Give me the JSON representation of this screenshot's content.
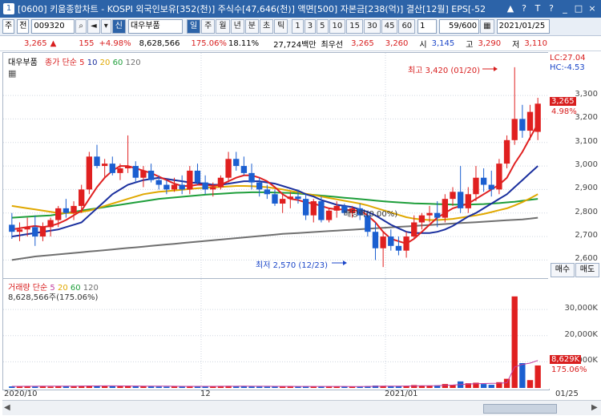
{
  "window": {
    "app_number": "1",
    "title": "[0600] 키움종합차트 - KOSPI 외국인보유[352(천)] 주식수[47,646(천)] 액면[500] 자본금[238(억)] 결산[12월] EPS[-52",
    "controls": [
      "▲",
      "?",
      "T",
      "?",
      "_",
      "□",
      "×"
    ]
  },
  "toolbar": {
    "market": "주",
    "market2": "전",
    "code": "009320",
    "name": "대우부품",
    "periods": [
      "일",
      "주",
      "월",
      "년",
      "분",
      "초",
      "틱"
    ],
    "minutes": [
      "1",
      "3",
      "5",
      "10",
      "15",
      "30",
      "45",
      "60"
    ],
    "count": "1",
    "page": "59/600",
    "date": "2021/01/25"
  },
  "quote": {
    "price": "3,265",
    "change_mark": "▲",
    "change": "155",
    "change_pct": "+4.98%",
    "volume": "8,628,566",
    "volume_ratio": "175.06%",
    "turnover": "18.11%",
    "amount": "27,724백만",
    "best_ask_label": "최우선",
    "best_ask": "3,265",
    "best_bid": "3,260",
    "open_label": "시",
    "open": "3,145",
    "high_label": "고",
    "high": "3,290",
    "low_label": "저",
    "low": "3,110"
  },
  "price_panel": {
    "legend_name": "대우부품",
    "legend_type": "종가 단순",
    "ma": [
      {
        "label": "5",
        "color": "#e02020"
      },
      {
        "label": "10",
        "color": "#1a2f9e"
      },
      {
        "label": "20",
        "color": "#e0a800"
      },
      {
        "label": "60",
        "color": "#1e9e3a"
      },
      {
        "label": "120",
        "color": "#707070"
      }
    ],
    "annot_high": "최고 3,420 (01/20)",
    "annot_low": "최저 2,570 (12/23)",
    "annot_div": "배당락(0.00%)",
    "lc": "LC:27.04",
    "hc": "HC:-4.53",
    "price_tag": "3,265",
    "pct_tag": "4.98%"
  },
  "volume_panel": {
    "legend_name": "거래량",
    "legend_type": "단순",
    "ma": [
      "5",
      "20",
      "60",
      "120"
    ],
    "summary": "8,628,566주(175.06%)",
    "vol_tag": "8,629K",
    "vol_pct_tag": "175.06%"
  },
  "right_buttons": {
    "buy": "매수",
    "sell": "매도"
  },
  "chart_data": {
    "type": "candlestick",
    "y_ticks": [
      "3,300",
      "3,200",
      "3,100",
      "3,000",
      "2,900",
      "2,800",
      "2,700",
      "2,600"
    ],
    "ylim": [
      2540,
      3440
    ],
    "volume_ticks": [
      "30,000K",
      "20,000K",
      "10,000K"
    ],
    "x_labels": [
      "2020/10",
      "12",
      "2021/01",
      "01/25"
    ],
    "candles": [
      [
        2750,
        2800,
        2690,
        2720
      ],
      [
        2720,
        2760,
        2680,
        2730
      ],
      [
        2730,
        2780,
        2700,
        2740
      ],
      [
        2740,
        2790,
        2660,
        2700
      ],
      [
        2700,
        2760,
        2680,
        2740
      ],
      [
        2740,
        2780,
        2700,
        2770
      ],
      [
        2770,
        2830,
        2740,
        2820
      ],
      [
        2820,
        2860,
        2780,
        2800
      ],
      [
        2800,
        2850,
        2770,
        2830
      ],
      [
        2830,
        2920,
        2800,
        2900
      ],
      [
        2900,
        3060,
        2880,
        3040
      ],
      [
        3040,
        3090,
        2990,
        3000
      ],
      [
        3000,
        3030,
        2950,
        3010
      ],
      [
        3010,
        3040,
        2960,
        2970
      ],
      [
        2970,
        3010,
        2940,
        2990
      ],
      [
        2990,
        3130,
        2970,
        3000
      ],
      [
        3000,
        3020,
        2930,
        2950
      ],
      [
        2950,
        3000,
        2910,
        2980
      ],
      [
        2980,
        3010,
        2930,
        2940
      ],
      [
        2940,
        2960,
        2900,
        2920
      ],
      [
        2920,
        2940,
        2880,
        2900
      ],
      [
        2900,
        2950,
        2890,
        2920
      ],
      [
        2920,
        2960,
        2880,
        2900
      ],
      [
        2900,
        3000,
        2880,
        2980
      ],
      [
        2980,
        3010,
        2920,
        2930
      ],
      [
        2930,
        2960,
        2880,
        2900
      ],
      [
        2900,
        2930,
        2870,
        2910
      ],
      [
        2910,
        2960,
        2900,
        2950
      ],
      [
        2950,
        3060,
        2930,
        3030
      ],
      [
        3030,
        3060,
        2980,
        3000
      ],
      [
        3000,
        3040,
        2960,
        2970
      ],
      [
        2970,
        3010,
        2900,
        2930
      ],
      [
        2930,
        2950,
        2870,
        2900
      ],
      [
        2900,
        2920,
        2860,
        2880
      ],
      [
        2880,
        2900,
        2830,
        2840
      ],
      [
        2840,
        2880,
        2800,
        2860
      ],
      [
        2860,
        2890,
        2820,
        2870
      ],
      [
        2870,
        2900,
        2840,
        2860
      ],
      [
        2860,
        2880,
        2770,
        2790
      ],
      [
        2790,
        2860,
        2760,
        2850
      ],
      [
        2850,
        2870,
        2760,
        2770
      ],
      [
        2770,
        2820,
        2760,
        2810
      ],
      [
        2810,
        2850,
        2780,
        2830
      ],
      [
        2830,
        2840,
        2790,
        2800
      ],
      [
        2800,
        2830,
        2780,
        2820
      ],
      [
        2820,
        2840,
        2770,
        2790
      ],
      [
        2790,
        2800,
        2700,
        2720
      ],
      [
        2720,
        2760,
        2600,
        2650
      ],
      [
        2650,
        2720,
        2570,
        2700
      ],
      [
        2700,
        2730,
        2640,
        2660
      ],
      [
        2660,
        2700,
        2620,
        2640
      ],
      [
        2640,
        2720,
        2610,
        2700
      ],
      [
        2700,
        2790,
        2690,
        2760
      ],
      [
        2760,
        2800,
        2730,
        2790
      ],
      [
        2790,
        2830,
        2760,
        2800
      ],
      [
        2800,
        2850,
        2740,
        2780
      ],
      [
        2780,
        2880,
        2760,
        2860
      ],
      [
        2860,
        2910,
        2830,
        2890
      ],
      [
        2890,
        3000,
        2800,
        2820
      ],
      [
        2820,
        2910,
        2800,
        2880
      ],
      [
        2880,
        3000,
        2850,
        2950
      ],
      [
        2950,
        2990,
        2890,
        2920
      ],
      [
        2920,
        2980,
        2870,
        2900
      ],
      [
        2900,
        3030,
        2880,
        3010
      ],
      [
        3010,
        3130,
        2990,
        3110
      ],
      [
        3110,
        3420,
        3090,
        3200
      ],
      [
        3200,
        3260,
        3120,
        3150
      ],
      [
        3150,
        3260,
        3110,
        3230
      ],
      [
        3145,
        3290,
        3110,
        3265
      ]
    ],
    "volumes": [
      600,
      500,
      700,
      550,
      600,
      500,
      650,
      700,
      600,
      750,
      900,
      800,
      700,
      650,
      600,
      850,
      700,
      650,
      600,
      550,
      500,
      600,
      550,
      650,
      700,
      600,
      550,
      600,
      800,
      700,
      650,
      600,
      550,
      500,
      600,
      550,
      600,
      550,
      650,
      600,
      500,
      550,
      600,
      500,
      550,
      600,
      700,
      900,
      800,
      700,
      650,
      800,
      1100,
      900,
      850,
      1000,
      1500,
      1200,
      2500,
      1800,
      2000,
      1500,
      1200,
      2200,
      3500,
      35000,
      9500,
      3000,
      8600
    ],
    "ma5": [
      2730,
      2735,
      2740,
      2745,
      2740,
      2745,
      2755,
      2770,
      2790,
      2810,
      2860,
      2910,
      2950,
      2980,
      3000,
      3000,
      2990,
      2980,
      2970,
      2955,
      2940,
      2925,
      2915,
      2915,
      2920,
      2920,
      2915,
      2920,
      2935,
      2950,
      2960,
      2960,
      2950,
      2935,
      2910,
      2880,
      2860,
      2855,
      2845,
      2840,
      2830,
      2820,
      2815,
      2815,
      2810,
      2810,
      2790,
      2760,
      2720,
      2690,
      2680,
      2670,
      2690,
      2720,
      2750,
      2780,
      2800,
      2820,
      2830,
      2840,
      2860,
      2880,
      2900,
      2920,
      2950,
      3010,
      3060,
      3120,
      3180
    ],
    "ma10": [
      2700,
      2705,
      2710,
      2715,
      2720,
      2725,
      2730,
      2740,
      2750,
      2760,
      2790,
      2820,
      2850,
      2880,
      2900,
      2920,
      2930,
      2940,
      2945,
      2950,
      2945,
      2940,
      2935,
      2930,
      2928,
      2925,
      2920,
      2920,
      2925,
      2930,
      2935,
      2935,
      2935,
      2930,
      2925,
      2915,
      2905,
      2895,
      2880,
      2870,
      2855,
      2845,
      2835,
      2830,
      2825,
      2815,
      2805,
      2790,
      2770,
      2750,
      2735,
      2720,
      2715,
      2715,
      2715,
      2720,
      2730,
      2745,
      2765,
      2785,
      2800,
      2820,
      2840,
      2860,
      2880,
      2910,
      2940,
      2970,
      3000
    ],
    "ma20": [
      2830,
      2825,
      2820,
      2815,
      2810,
      2805,
      2800,
      2800,
      2800,
      2805,
      2810,
      2820,
      2830,
      2840,
      2850,
      2860,
      2870,
      2880,
      2885,
      2890,
      2893,
      2896,
      2899,
      2902,
      2905,
      2907,
      2909,
      2911,
      2913,
      2915,
      2915,
      2914,
      2912,
      2910,
      2905,
      2900,
      2894,
      2888,
      2882,
      2876,
      2870,
      2864,
      2858,
      2852,
      2846,
      2840,
      2832,
      2822,
      2812,
      2802,
      2792,
      2782,
      2776,
      2772,
      2770,
      2770,
      2772,
      2775,
      2780,
      2785,
      2790,
      2796,
      2804,
      2812,
      2820,
      2832,
      2846,
      2862,
      2880
    ],
    "ma60": [
      2780,
      2782,
      2784,
      2786,
      2788,
      2790,
      2795,
      2800,
      2805,
      2810,
      2815,
      2820,
      2825,
      2830,
      2835,
      2840,
      2845,
      2850,
      2855,
      2860,
      2863,
      2866,
      2869,
      2872,
      2875,
      2878,
      2880,
      2882,
      2884,
      2886,
      2887,
      2888,
      2888,
      2888,
      2887,
      2886,
      2885,
      2883,
      2880,
      2877,
      2874,
      2871,
      2868,
      2865,
      2862,
      2859,
      2856,
      2853,
      2850,
      2847,
      2845,
      2843,
      2841,
      2840,
      2839,
      2838,
      2837,
      2836,
      2836,
      2836,
      2837,
      2838,
      2840,
      2842,
      2845,
      2848,
      2852,
      2856,
      2860
    ],
    "ma120": [
      2600,
      2605,
      2610,
      2615,
      2618,
      2621,
      2624,
      2627,
      2630,
      2633,
      2636,
      2639,
      2642,
      2645,
      2648,
      2651,
      2654,
      2657,
      2660,
      2663,
      2666,
      2669,
      2672,
      2675,
      2678,
      2681,
      2684,
      2687,
      2690,
      2693,
      2696,
      2699,
      2702,
      2705,
      2708,
      2711,
      2713,
      2715,
      2717,
      2719,
      2721,
      2723,
      2725,
      2727,
      2729,
      2731,
      2733,
      2735,
      2737,
      2739,
      2741,
      2743,
      2745,
      2747,
      2749,
      2751,
      2753,
      2755,
      2757,
      2759,
      2761,
      2763,
      2765,
      2767,
      2769,
      2771,
      2773,
      2776,
      2780
    ],
    "vma5": [
      600,
      620,
      640,
      650,
      660,
      670,
      690,
      700,
      720,
      740,
      760,
      780,
      800,
      790,
      770,
      750,
      730,
      720,
      700,
      680,
      660,
      640,
      620,
      610,
      600,
      610,
      620,
      630,
      640,
      650,
      660,
      650,
      640,
      630,
      620,
      610,
      600,
      590,
      590,
      590,
      580,
      580,
      570,
      570,
      560,
      560,
      580,
      620,
      660,
      700,
      720,
      740,
      780,
      820,
      860,
      900,
      1000,
      1100,
      1300,
      1500,
      1600,
      1700,
      1750,
      1800,
      2000,
      8000,
      9000,
      9500,
      10500
    ]
  }
}
